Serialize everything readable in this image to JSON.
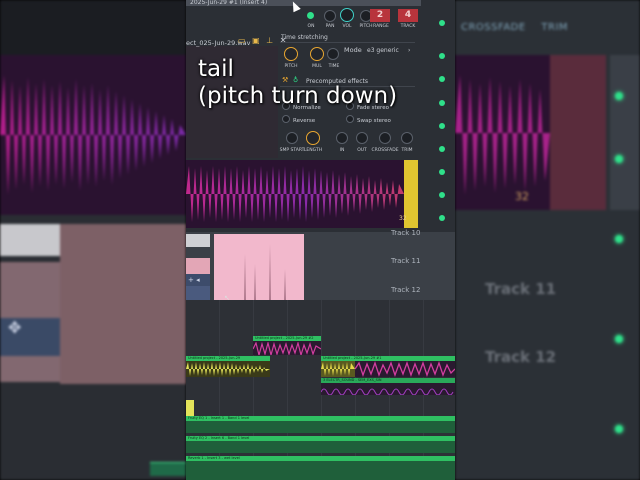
{
  "window": {
    "title": "2025-Jun-29 #1 (Insert 4)",
    "sample_name": "ect_025-Jun-29.wav"
  },
  "top_knobs": [
    {
      "label": "ON"
    },
    {
      "label": "PAN"
    },
    {
      "label": "VOL"
    },
    {
      "label": "PITCH"
    },
    {
      "label": "RANGE",
      "value": "2"
    },
    {
      "label": "TRACK",
      "value": "4"
    }
  ],
  "time_stretching": {
    "title": "Time stretching",
    "knobs": [
      "PITCH",
      "MUL",
      "TIME"
    ],
    "mode_label": "Mode",
    "mode_value": "e3 generic"
  },
  "precomputed": {
    "title": "Precomputed effects",
    "options": [
      "Normalize",
      "Fade stereo",
      "Reverse",
      "Swap stereo"
    ],
    "knobs": [
      "SMP START",
      "LENGTH",
      "IN",
      "OUT",
      "CROSSFADE",
      "TRIM"
    ]
  },
  "waveform_number": "32",
  "caption": {
    "line1": "tail",
    "line2": "(pitch turn down)"
  },
  "tracks": [
    "Track 10",
    "Track 11",
    "Track 12"
  ],
  "clips": [
    {
      "name": "Untitled project - 2025-Jun-29 #2"
    },
    {
      "name": "Untitled project - 2025-Jun-29"
    },
    {
      "name": "Untitled project - 2025-Jun-29 #1"
    },
    {
      "name": "3 ELECTR_SOUND - SEM_EXS_SIN"
    }
  ],
  "automation": [
    "Fruity EQ 1 - Insert 1 - Band 1 level",
    "Fruity EQ 2 - Insert 6 - Band 1 level",
    "Reverb 1 - Insert 3 - wet level"
  ],
  "right_bg": {
    "headers": [
      "CROSSFADE",
      "TRIM"
    ],
    "tracks": [
      "Track 11",
      "Track 12"
    ],
    "number": "32"
  },
  "colors": {
    "accent": "#e8a630",
    "clip_green": "#2fbf62",
    "led_green": "#2fe08a",
    "wave_magenta": "#c0288c",
    "wave_yellow": "#e0c530",
    "sample_pink": "#f2b8cc"
  }
}
